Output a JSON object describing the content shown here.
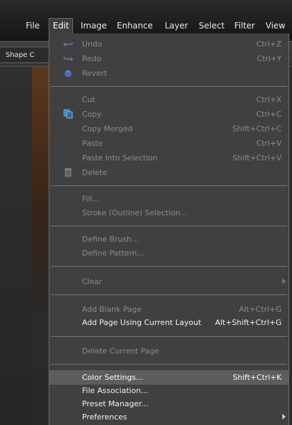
{
  "menubar": {
    "items": [
      {
        "label": "File"
      },
      {
        "label": "Edit"
      },
      {
        "label": "Image"
      },
      {
        "label": "Enhance"
      },
      {
        "label": "Layer"
      },
      {
        "label": "Select"
      },
      {
        "label": "Filter"
      },
      {
        "label": "View"
      }
    ],
    "active": "Edit"
  },
  "options_bar": {
    "tool_tab_label": "Shape C"
  },
  "edit_menu": {
    "items": [
      {
        "label": "Undo",
        "shortcut": "Ctrl+Z",
        "enabled": false,
        "icon": "undo-arrow-icon"
      },
      {
        "label": "Redo",
        "shortcut": "Ctrl+Y",
        "enabled": false,
        "icon": "redo-arrow-icon"
      },
      {
        "label": "Revert",
        "shortcut": "",
        "enabled": false,
        "icon": "revert-icon"
      },
      {
        "label": "Cut",
        "shortcut": "Ctrl+X",
        "enabled": false
      },
      {
        "label": "Copy",
        "shortcut": "Ctrl+C",
        "enabled": false,
        "icon": "copy-icon"
      },
      {
        "label": "Copy Merged",
        "shortcut": "Shift+Ctrl+C",
        "enabled": false
      },
      {
        "label": "Paste",
        "shortcut": "Ctrl+V",
        "enabled": false
      },
      {
        "label": "Paste Into Selection",
        "shortcut": "Shift+Ctrl+V",
        "enabled": false
      },
      {
        "label": "Delete",
        "shortcut": "",
        "enabled": false,
        "icon": "trash-icon"
      },
      {
        "label": "Fill...",
        "shortcut": "",
        "enabled": false
      },
      {
        "label": "Stroke (Outline) Selection...",
        "shortcut": "",
        "enabled": false
      },
      {
        "label": "Define Brush...",
        "shortcut": "",
        "enabled": false
      },
      {
        "label": "Define Pattern...",
        "shortcut": "",
        "enabled": false
      },
      {
        "label": "Clear",
        "shortcut": "",
        "enabled": false,
        "submenu": true
      },
      {
        "label": "Add Blank Page",
        "shortcut": "Alt+Ctrl+G",
        "enabled": false
      },
      {
        "label": "Add Page Using Current Layout",
        "shortcut": "Alt+Shift+Ctrl+G",
        "enabled": true
      },
      {
        "label": "Delete Current Page",
        "shortcut": "",
        "enabled": false
      },
      {
        "label": "Color Settings...",
        "shortcut": "Shift+Ctrl+K",
        "enabled": true,
        "highlighted": true
      },
      {
        "label": "File Association...",
        "shortcut": "",
        "enabled": true
      },
      {
        "label": "Preset Manager...",
        "shortcut": "",
        "enabled": true
      },
      {
        "label": "Preferences",
        "shortcut": "",
        "enabled": true,
        "submenu": true
      }
    ]
  },
  "colors": {
    "menu_background": "#404040",
    "menu_disabled_text": "#8c8c8c",
    "menu_enabled_text": "#f2f2f2",
    "menu_highlight": "#5d5d5d",
    "menubar_background": "#1f1f1f"
  }
}
